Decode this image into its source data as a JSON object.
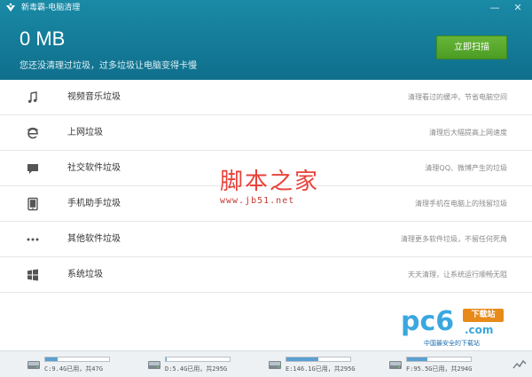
{
  "window": {
    "title": "新毒霸-电脑清理",
    "minimize_glyph": "—",
    "close_glyph": "✕"
  },
  "summary": {
    "size": "0 MB",
    "message": "您还没清理过垃圾，过多垃圾让电脑变得卡慢",
    "scan_button": "立即扫描"
  },
  "categories": [
    {
      "label": "视频音乐垃圾",
      "desc": "清理看过的缓冲，节省电脑空间",
      "icon": "music-note-icon"
    },
    {
      "label": "上网垃圾",
      "desc": "清理后大幅提高上网速度",
      "icon": "ie-browser-icon"
    },
    {
      "label": "社交软件垃圾",
      "desc": "清理QQ、微博产生的垃圾",
      "icon": "chat-bubble-icon"
    },
    {
      "label": "手机助手垃圾",
      "desc": "清理手机在电脑上的残留垃圾",
      "icon": "tablet-icon"
    },
    {
      "label": "其他软件垃圾",
      "desc": "清理更多软件垃圾，不留任何死角",
      "icon": "more-dots-icon"
    },
    {
      "label": "系统垃圾",
      "desc": "天天清理，让系统运行顺畅无阻",
      "icon": "windows-logo-icon"
    }
  ],
  "watermark": {
    "title": "脚本之家",
    "url": "www.jb51.net"
  },
  "pc6": {
    "big": "pc6",
    "download": "下载站",
    "domain": ".com",
    "slogan": "中国最安全的下载站"
  },
  "drives": [
    {
      "text": "C:9.4G已用，共47G",
      "used": 0.2
    },
    {
      "text": "D:5.4G已用，共295G",
      "used": 0.02
    },
    {
      "text": "E:146.1G已用，共295G",
      "used": 0.5
    },
    {
      "text": "F:95.5G已用，共294G",
      "used": 0.32
    }
  ],
  "colors": {
    "header": "#137c98",
    "scan_button": "#58a82e",
    "watermark": "#e8423a",
    "pc6_blue": "#3aa7e0",
    "pc6_orange": "#e88a1a"
  }
}
